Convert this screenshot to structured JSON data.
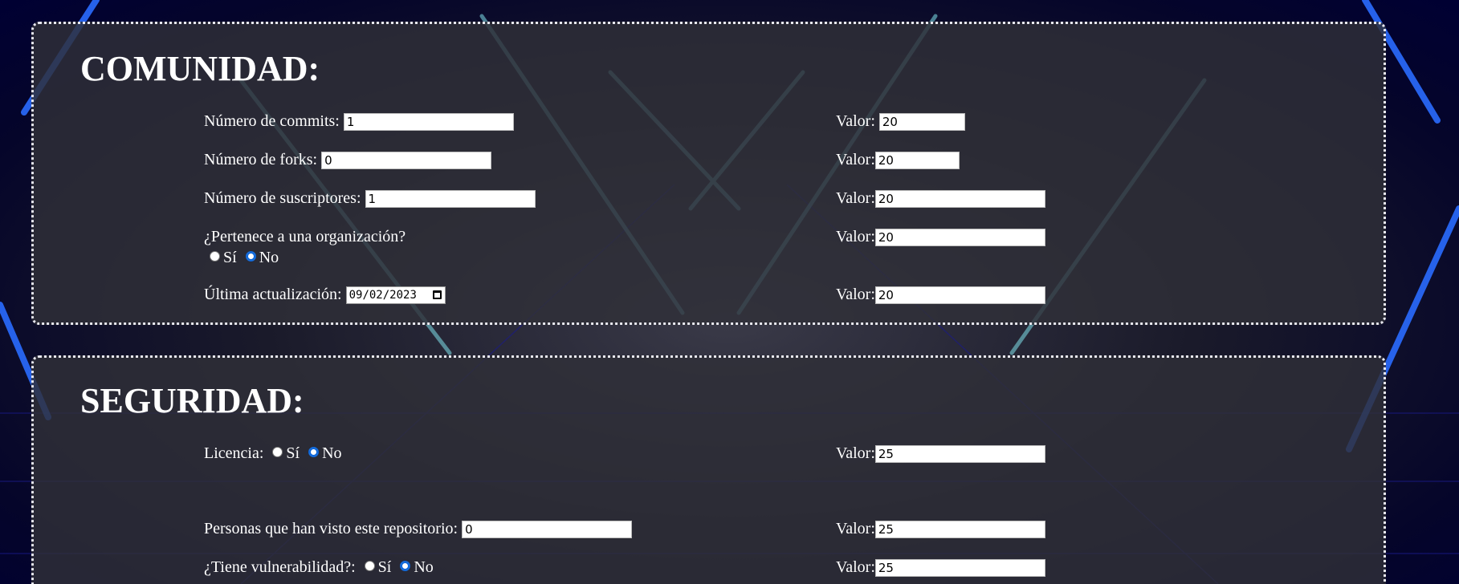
{
  "comunidad": {
    "title": "COMUNIDAD:",
    "commits": {
      "label": "Número de commits:",
      "value": "1",
      "valor_label": "Valor:",
      "valor": "20"
    },
    "forks": {
      "label": "Número de forks:",
      "value": "0",
      "valor_label": "Valor:",
      "valor": "20"
    },
    "suscriptores": {
      "label": "Número de suscriptores:",
      "value": "1",
      "valor_label": "Valor:",
      "valor": "20"
    },
    "organizacion": {
      "label": "¿Pertenece a una organización?",
      "si": "Sí",
      "no": "No",
      "selected": "No",
      "valor_label": "Valor:",
      "valor": "20"
    },
    "actualizacion": {
      "label": "Última actualización:",
      "date": "09/02/2023",
      "valor_label": "Valor:",
      "valor": "20"
    }
  },
  "seguridad": {
    "title": "SEGURIDAD:",
    "licencia": {
      "label": "Licencia:",
      "si": "Sí",
      "no": "No",
      "selected": "No",
      "valor_label": "Valor:",
      "valor": "25"
    },
    "visto": {
      "label": "Personas que han visto este repositorio:",
      "value": "0",
      "valor_label": "Valor:",
      "valor": "25"
    },
    "vulnerabilidad": {
      "label": "¿Tiene vulnerabilidad?:",
      "si": "Sí",
      "no": "No",
      "selected": "No",
      "valor_label": "Valor:",
      "valor": "25"
    }
  },
  "colors": {
    "panel_border": "#e8e8f0",
    "radio_accent": "#0a64d8",
    "neon_blue": "#2a6cff",
    "neon_cyan": "#7fe0ea"
  }
}
